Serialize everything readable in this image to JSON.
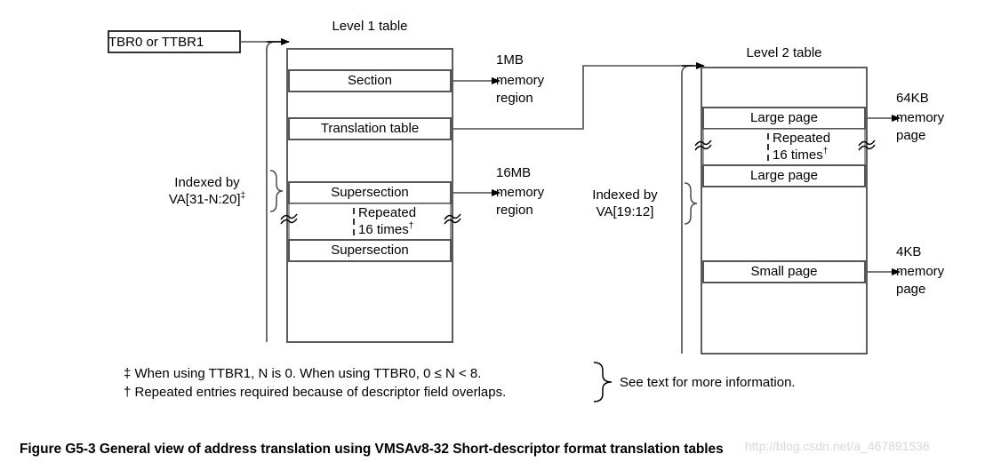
{
  "figure": {
    "caption": "Figure G5-3 General view of address translation using VMSAv8-32 Short-descriptor format translation tables",
    "ghost_text": "http://blog.csdn.net/a_467891536"
  },
  "pointer_box": {
    "label": "TBR0 or TTBR1"
  },
  "level1": {
    "title": "Level 1 table",
    "index_label_line1": "Indexed by",
    "index_label_line2": "VA[31-N:20]",
    "index_label_marker": "‡",
    "rows": [
      {
        "label": "",
        "name": "empty-row"
      },
      {
        "label": "Section",
        "name": "section-entry"
      },
      {
        "label": "",
        "name": "empty-row"
      },
      {
        "label": "Translation table",
        "name": "translation-table-entry"
      },
      {
        "label": "",
        "name": "empty-row"
      },
      {
        "label": "Supersection",
        "name": "supersection-entry-top"
      },
      {
        "label": "Repeated",
        "label2": "16 times",
        "marker": "†",
        "name": "repeated-entries"
      },
      {
        "label": "Supersection",
        "name": "supersection-entry-bottom"
      },
      {
        "label": "",
        "name": "empty-row"
      }
    ]
  },
  "level2": {
    "title": "Level 2 table",
    "index_label_line1": "Indexed by",
    "index_label_line2": "VA[19:12]",
    "rows": [
      {
        "label": "",
        "name": "empty-row"
      },
      {
        "label": "Large page",
        "name": "large-page-entry-top"
      },
      {
        "label": "Repeated",
        "label2": "16 times",
        "marker": "†",
        "name": "repeated-entries"
      },
      {
        "label": "Large page",
        "name": "large-page-entry-bottom"
      },
      {
        "label": "",
        "name": "empty-row"
      },
      {
        "label": "Small page",
        "name": "small-page-entry"
      },
      {
        "label": "",
        "name": "empty-row"
      }
    ]
  },
  "outputs": {
    "section_region": {
      "line1": "1MB",
      "line2": "memory",
      "line3": "region"
    },
    "supersection_region": {
      "line1": "16MB",
      "line2": "memory",
      "line3": "region"
    },
    "large_page": {
      "line1": "64KB",
      "line2": "memory",
      "line3": "page"
    },
    "small_page": {
      "line1": "4KB",
      "line2": "memory",
      "line3": "page"
    }
  },
  "footnotes": {
    "note_double_dagger": "‡ When using TTBR1, N is 0. When using TTBR0, 0 ≤ N < 8.",
    "note_dagger": "† Repeated entries required because of descriptor field overlaps.",
    "see_text": "See text for more information."
  },
  "colors": {
    "stroke": "#3a3a3a",
    "stroke_dark": "#000000",
    "text": "#000000",
    "background": "#ffffff",
    "ghost": "#d8d8d8"
  }
}
